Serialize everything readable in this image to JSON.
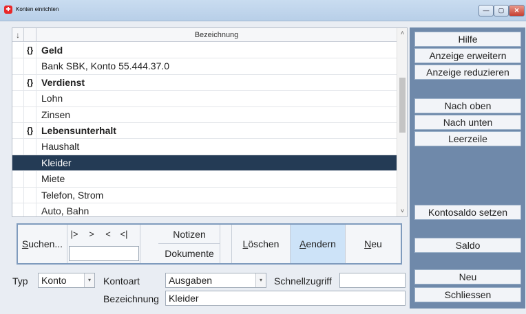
{
  "window": {
    "title": "Konten einrichten",
    "app_icon": "app-logo-icon",
    "controls": {
      "minimize": "—",
      "maximize": "▢",
      "close": "✕"
    }
  },
  "grid": {
    "header": {
      "sort_icon": "↓",
      "title": "Bezeichnung"
    },
    "rows": [
      {
        "marker": "{}",
        "text": "Geld",
        "type": "group"
      },
      {
        "marker": "",
        "text": "Bank SBK, Konto 55.444.37.0",
        "type": "item"
      },
      {
        "marker": "{}",
        "text": "Verdienst",
        "type": "group"
      },
      {
        "marker": "",
        "text": "Lohn",
        "type": "item"
      },
      {
        "marker": "",
        "text": "Zinsen",
        "type": "item"
      },
      {
        "marker": "{}",
        "text": "Lebensunterhalt",
        "type": "group"
      },
      {
        "marker": "",
        "text": "Haushalt",
        "type": "item"
      },
      {
        "marker": "",
        "text": "Kleider",
        "type": "item",
        "selected": true
      },
      {
        "marker": "",
        "text": "Miete",
        "type": "item"
      },
      {
        "marker": "",
        "text": "Telefon, Strom",
        "type": "item"
      },
      {
        "marker": "",
        "text": "Auto, Bahn",
        "type": "item"
      }
    ],
    "scroll_up": "˄",
    "scroll_down": "˅"
  },
  "toolbar": {
    "suchen": "Suchen...",
    "nav": {
      "first": "|>",
      "next": ">",
      "prev": "<",
      "last": "<|"
    },
    "search_value": "",
    "notizen": "Notizen",
    "dokumente": "Dokumente",
    "loeschen": "Löschen",
    "aendern": "Aendern",
    "neu": "Neu"
  },
  "form": {
    "typ_label": "Typ",
    "typ_value": "Konto",
    "kontoart_label": "Kontoart",
    "kontoart_value": "Ausgaben",
    "schnell_label": "Schnellzugriff",
    "schnell_value": "",
    "bez_label": "Bezeichnung",
    "bez_value": "Kleider",
    "dropdown_icon": "▾"
  },
  "side": {
    "hilfe": "Hilfe",
    "erweitern": "Anzeige erweitern",
    "reduzieren": "Anzeige reduzieren",
    "oben": "Nach oben",
    "unten": "Nach unten",
    "leerzeile": "Leerzeile",
    "kontosaldo": "Kontosaldo setzen",
    "saldo": "Saldo",
    "neu": "Neu",
    "schliessen": "Schliessen"
  }
}
